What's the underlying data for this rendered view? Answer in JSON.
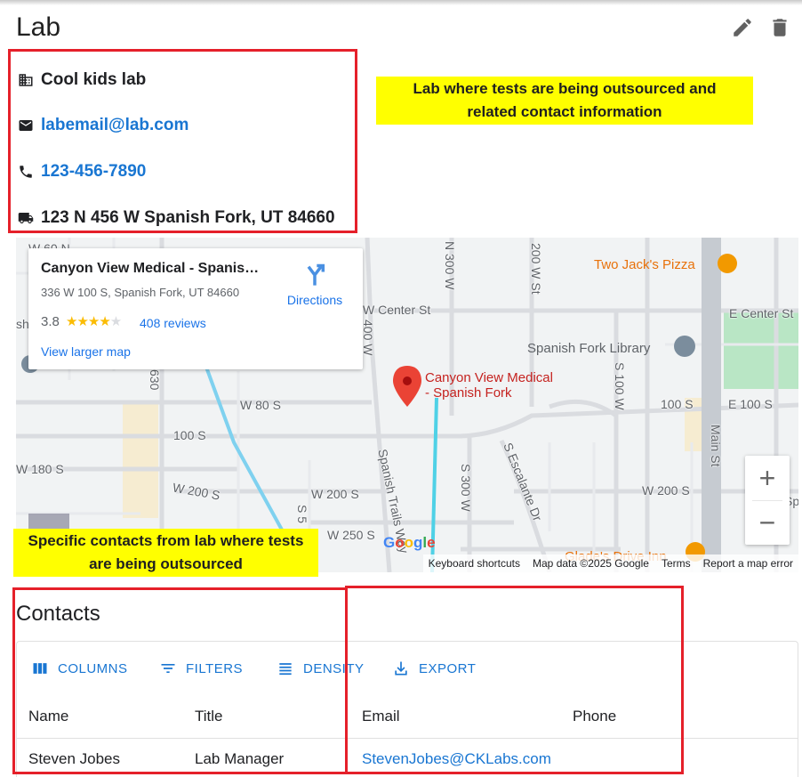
{
  "page": {
    "title": "Lab"
  },
  "lab": {
    "name": "Cool kids lab",
    "email": "labemail@lab.com",
    "phone": "123-456-7890",
    "address": "123 N 456 W Spanish Fork, UT 84660"
  },
  "annotations": {
    "lab_info_line1": "Lab where tests are being outsourced and",
    "lab_info_line2": "related contact information",
    "contacts_line1": "Specific contacts from lab where tests",
    "contacts_line2": "are being outsourced"
  },
  "map": {
    "place_name": "Canyon View Medical - Spanis…",
    "place_address": "336 W 100 S, Spanish Fork, UT 84660",
    "rating": "3.8",
    "stars": "★★★★",
    "star_off": "★",
    "reviews": "408 reviews",
    "directions": "Directions",
    "view_larger": "View larger map",
    "pin_label_line1": "Canyon View Medical",
    "pin_label_line2": "- Spanish Fork",
    "poi_pizza": "Two Jack's Pizza",
    "poi_library": "Spanish Fork Library",
    "poi_inn": "Glade's Drive Inn",
    "streets": {
      "w60n": "W 60 N",
      "n300w": "N 300 W",
      "n200w": "200 W St",
      "w_center": "W Center St",
      "e_center": "E Center St",
      "w80s": "W 80 S",
      "s100w": "S 100 W",
      "s400w": "400 W",
      "s100s": "100 S",
      "e100s": "E 100 S",
      "s100s_left": "100 S",
      "main": "Main St",
      "w180s": "W 180 S",
      "w200s_a": "W 200 S",
      "w200s_b": "W 200 S",
      "w200s_c": "W 200 S",
      "spanish_trails": "Spanish Trails Way",
      "s300w": "S 300 W",
      "escalante": "S Escalante Dr",
      "w250s": "W 250 S",
      "s630": "630",
      "sh": "sh",
      "s5": "S 5",
      "sp": "Sp"
    },
    "footer": {
      "shortcuts": "Keyboard shortcuts",
      "mapdata": "Map data ©2025 Google",
      "terms": "Terms",
      "report": "Report a map error"
    },
    "google": "Google",
    "zoom_in": "+",
    "zoom_out": "−"
  },
  "contacts": {
    "title": "Contacts",
    "toolbar": {
      "columns": "COLUMNS",
      "filters": "FILTERS",
      "density": "DENSITY",
      "export": "EXPORT"
    },
    "headers": [
      "Name",
      "Title",
      "Email",
      "Phone"
    ],
    "rows": [
      {
        "name": "Steven Jobes",
        "title": "Lab Manager",
        "email": "StevenJobes@CKLabs.com",
        "phone": ""
      }
    ]
  },
  "colors": {
    "accent": "#1976d2",
    "highlight": "#ffff00",
    "annotation_border": "#e5202a",
    "pin": "#ea4335"
  }
}
